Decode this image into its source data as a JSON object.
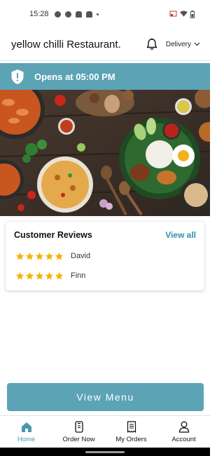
{
  "status_bar": {
    "time": "15:28"
  },
  "header": {
    "title": "yellow chilli Restaurant.",
    "delivery_label": "Delivery"
  },
  "banner": {
    "text": "Opens at 05:00 PM"
  },
  "reviews": {
    "title": "Customer Reviews",
    "view_all_label": "View all",
    "items": [
      {
        "name": "David",
        "rating": 5
      },
      {
        "name": "Finn",
        "rating": 5
      }
    ]
  },
  "view_menu_label": "View Menu",
  "bottom_nav": {
    "items": [
      {
        "label": "Home",
        "icon": "home-icon",
        "active": true
      },
      {
        "label": "Order Now",
        "icon": "phone-order-icon",
        "active": false
      },
      {
        "label": "My Orders",
        "icon": "receipt-icon",
        "active": false
      },
      {
        "label": "Account",
        "icon": "person-icon",
        "active": false
      }
    ]
  },
  "colors": {
    "accent": "#5ba3b5",
    "link": "#2f8fb0",
    "star": "#f5b301"
  }
}
